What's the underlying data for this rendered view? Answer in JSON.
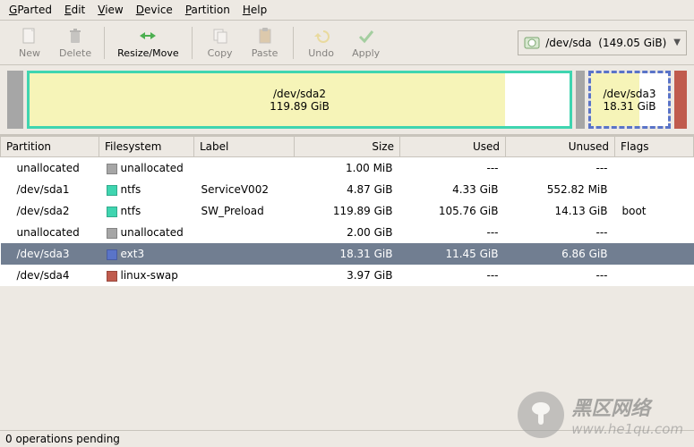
{
  "menu": {
    "gparted": "GParted",
    "edit": "Edit",
    "view": "View",
    "device": "Device",
    "partition": "Partition",
    "help": "Help"
  },
  "toolbar": {
    "new": "New",
    "delete": "Delete",
    "resize": "Resize/Move",
    "copy": "Copy",
    "paste": "Paste",
    "undo": "Undo",
    "apply": "Apply"
  },
  "device": {
    "path": "/dev/sda",
    "size": "(149.05 GiB)"
  },
  "map": {
    "sda2": {
      "label": "/dev/sda2",
      "size": "119.89 GiB",
      "used_pct": 88,
      "border": "#3fd5b0"
    },
    "sda3": {
      "label": "/dev/sda3",
      "size": "18.31 GiB",
      "used_pct": 63,
      "border": "#5a74c8"
    }
  },
  "columns": {
    "partition": "Partition",
    "filesystem": "Filesystem",
    "label": "Label",
    "size": "Size",
    "used": "Used",
    "unused": "Unused",
    "flags": "Flags"
  },
  "fs_colors": {
    "unallocated": "#a6a6a6",
    "ntfs": "#3fd5b0",
    "ext3": "#5a74c8",
    "linux-swap": "#c05b4d"
  },
  "rows": [
    {
      "partition": "unallocated",
      "indent": true,
      "fs": "unallocated",
      "label": "",
      "size": "1.00 MiB",
      "used": "---",
      "unused": "---",
      "flags": ""
    },
    {
      "partition": "/dev/sda1",
      "indent": true,
      "fs": "ntfs",
      "label": "ServiceV002",
      "size": "4.87 GiB",
      "used": "4.33 GiB",
      "unused": "552.82 MiB",
      "flags": ""
    },
    {
      "partition": "/dev/sda2",
      "indent": true,
      "fs": "ntfs",
      "label": "SW_Preload",
      "size": "119.89 GiB",
      "used": "105.76 GiB",
      "unused": "14.13 GiB",
      "flags": "boot"
    },
    {
      "partition": "unallocated",
      "indent": true,
      "fs": "unallocated",
      "label": "",
      "size": "2.00 GiB",
      "used": "---",
      "unused": "---",
      "flags": ""
    },
    {
      "partition": "/dev/sda3",
      "indent": true,
      "fs": "ext3",
      "label": "",
      "size": "18.31 GiB",
      "used": "11.45 GiB",
      "unused": "6.86 GiB",
      "flags": "",
      "selected": true
    },
    {
      "partition": "/dev/sda4",
      "indent": true,
      "fs": "linux-swap",
      "label": "",
      "size": "3.97 GiB",
      "used": "---",
      "unused": "---",
      "flags": ""
    }
  ],
  "status": "0 operations pending",
  "watermark": {
    "cn": "黑区网络",
    "url": "www.he1qu.com"
  }
}
